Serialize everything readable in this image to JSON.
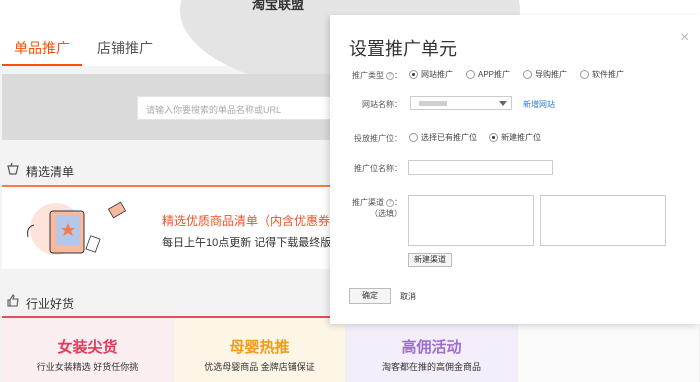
{
  "page": {
    "top_title": "淘宝联盟",
    "tabs": [
      {
        "label": "单品推广"
      },
      {
        "label": "店铺推广"
      }
    ],
    "search": {
      "placeholder": "请输入你要搜索的单品名称或URL"
    },
    "sections": [
      {
        "title": "精选清单"
      },
      {
        "title": "行业好货"
      }
    ],
    "promo": {
      "title": "精选优质商品清单（内含优惠券）",
      "subtitle": "每日上午10点更新 记得下载最终版本"
    },
    "cards": [
      {
        "title": "女装尖货",
        "subtitle": "行业女装精选 好货任你挑"
      },
      {
        "title": "母婴热推",
        "subtitle": "优选母婴商品 金牌店铺保证"
      },
      {
        "title": "高佣活动",
        "subtitle": "淘客都在推的高佣金商品"
      }
    ]
  },
  "modal": {
    "title": "设置推广单元",
    "close_symbol": "×",
    "promo_type": {
      "label": "推广类型",
      "options": [
        "网站推广",
        "APP推广",
        "导购推广",
        "软件推广"
      ],
      "selected": "网站推广"
    },
    "site_name": {
      "label": "网站名称",
      "new_site_link": "新增网站"
    },
    "placement": {
      "label": "投放推广位",
      "options": [
        "选择已有推广位",
        "新建推广位"
      ],
      "selected": "新建推广位"
    },
    "placement_name": {
      "label": "推广位名称"
    },
    "channel": {
      "label": "推广渠道",
      "optional_note": "（选填）",
      "new_channel_button": "新建渠道"
    },
    "confirm_button": "确定",
    "cancel_button": "取消"
  },
  "colors": {
    "accent": "#ff5000",
    "link": "#2b7bd8",
    "promo_title": "#f0502a"
  }
}
